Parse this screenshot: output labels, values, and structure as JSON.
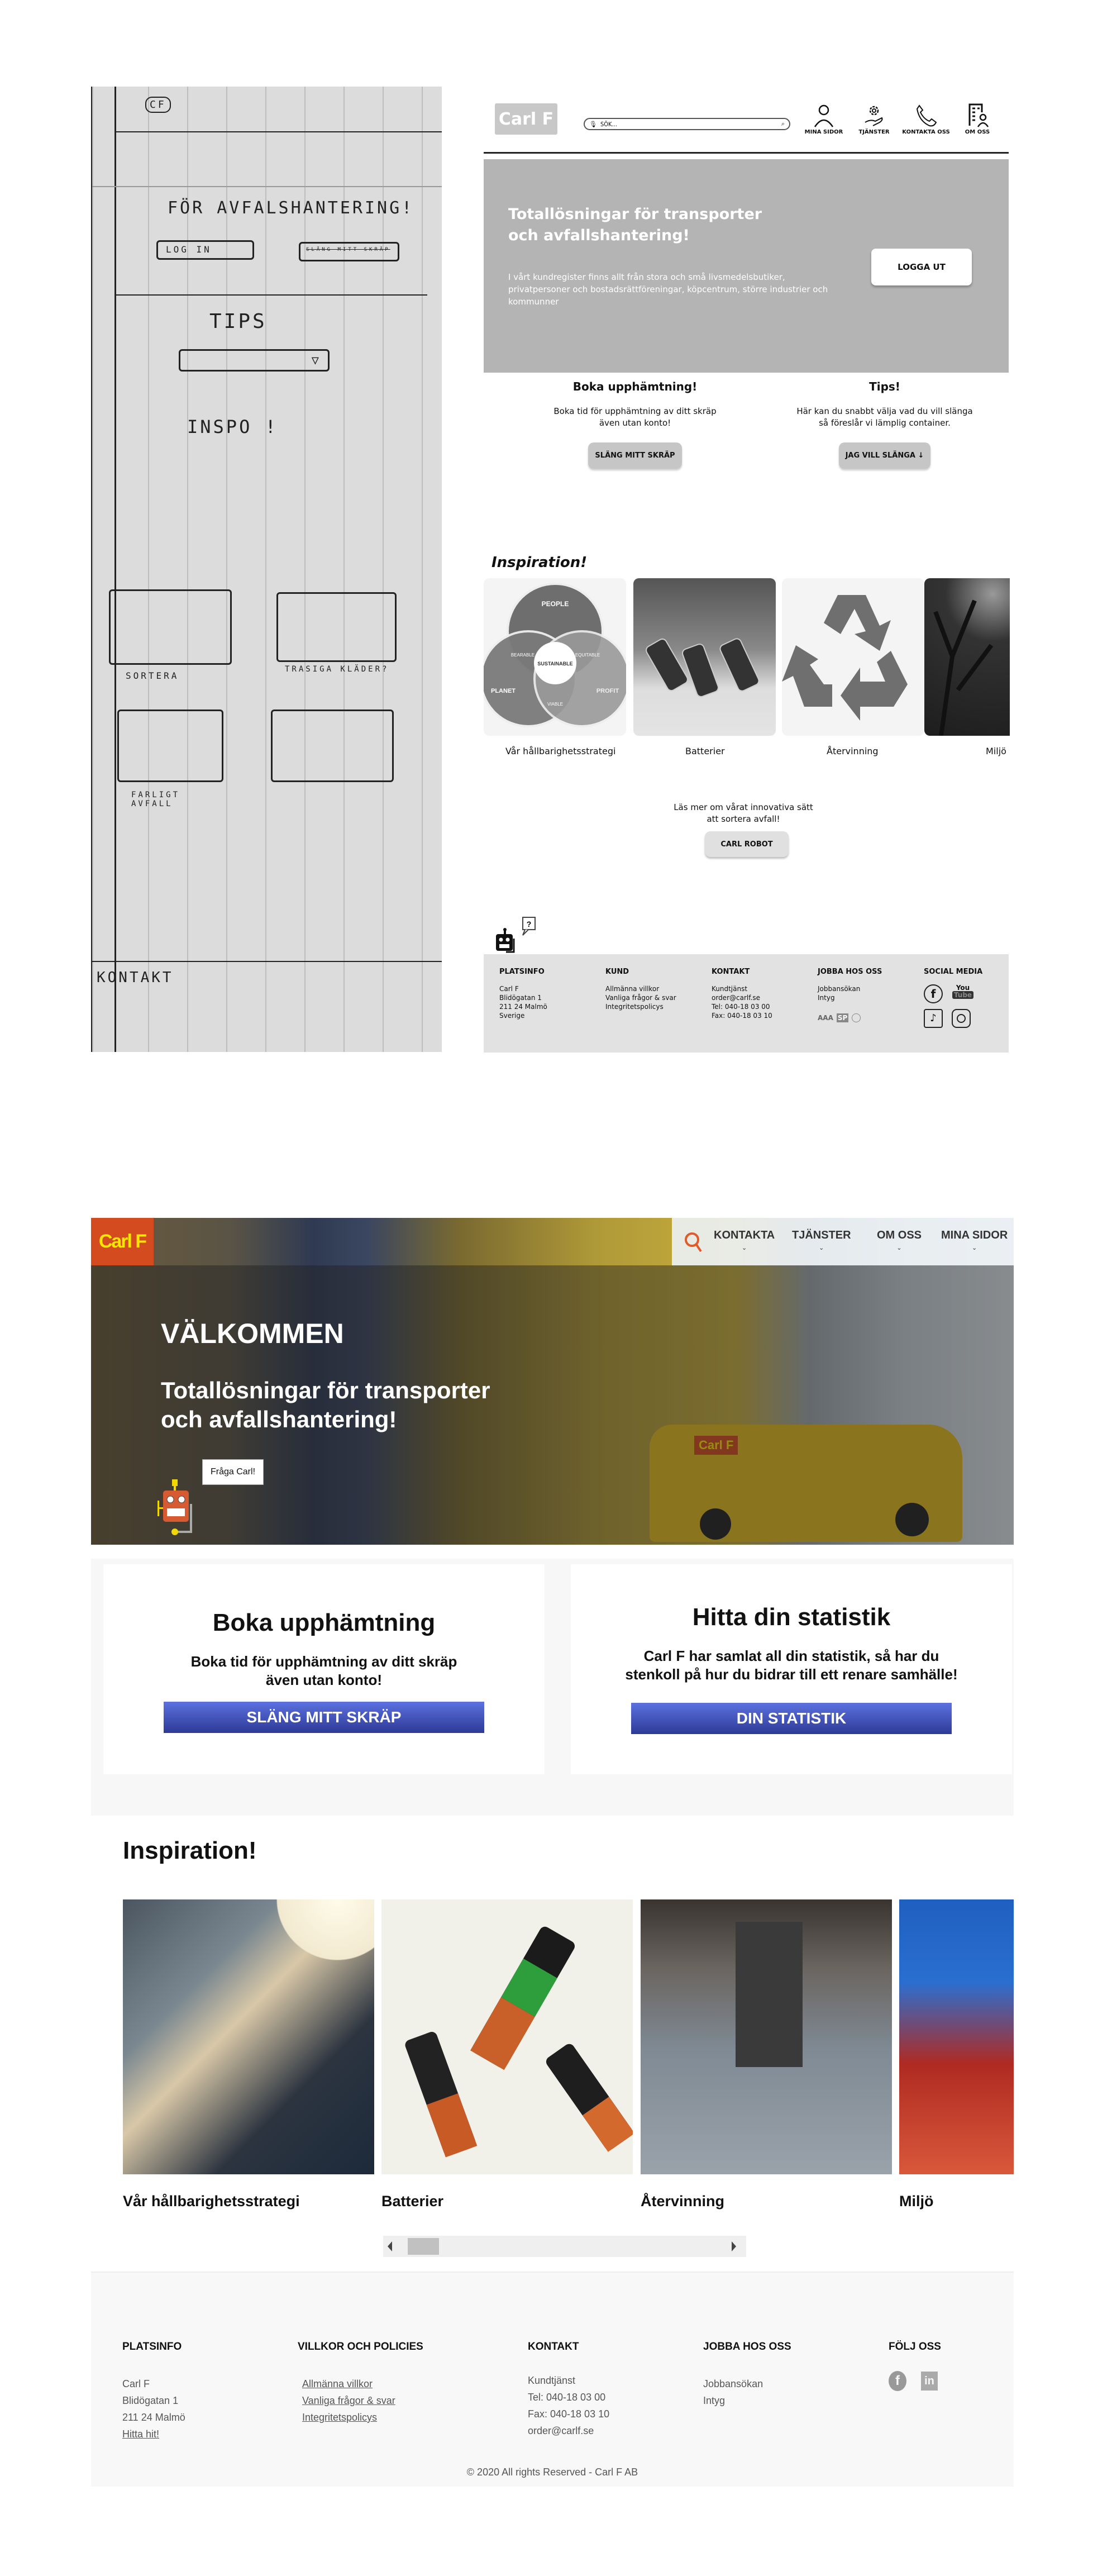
{
  "sketch": {
    "logo_scribble": "CF",
    "heading": "FÖR AVFALSHANTERING!",
    "login_button": "LOG IN",
    "second_button": "SLÄNG MITT SKRÄP",
    "tips_label": "TIPS",
    "inspo_label": "INSPO !",
    "cards": [
      {
        "label": "SORTERA"
      },
      {
        "label": "TRASIGA KLÄDER?"
      },
      {
        "label": "FARLIGT AVFALL"
      },
      {
        "label": ""
      }
    ],
    "footer_label": "KONTAKT"
  },
  "wireframe": {
    "logo": "Carl F",
    "search": {
      "placeholder": "SÖK..."
    },
    "nav": [
      {
        "label": "MINA SIDOR",
        "icon": "person-icon"
      },
      {
        "label": "TJÄNSTER",
        "icon": "gear-hand-icon"
      },
      {
        "label": "KONTAKTA OSS",
        "icon": "phone-icon"
      },
      {
        "label": "OM OSS",
        "icon": "building-person-icon"
      }
    ],
    "hero": {
      "title_line1": "Totallösningar för transporter",
      "title_line2": "och avfallshantering!",
      "body": "I vårt kundregister finns allt från stora och små livsmedelsbutiker, privatpersoner och bostadsrättföreningar, köpcentrum, större industrier och kommunner",
      "logout_button": "LOGGA UT"
    },
    "columns": [
      {
        "title": "Boka upphämtning!",
        "line1": "Boka tid för upphämtning av ditt skräp",
        "line2": "även utan konto!",
        "button": "SLÄNG MITT SKRÄP"
      },
      {
        "title": "Tips!",
        "line1": "Här kan du snabbt välja vad du vill slänga",
        "line2": "så föreslår vi lämplig container.",
        "button": "JAG VILL SLÄNGA ↓"
      }
    ],
    "inspiration": {
      "title": "Inspiration!",
      "venn": {
        "people": "PEOPLE",
        "planet": "PLANET",
        "profit": "PROFIT",
        "bearable": "BEARABLE",
        "equitable": "EQUITABLE",
        "viable": "VIABLE",
        "sustainable": "SUSTAINABLE"
      },
      "items": [
        {
          "caption": "Vår hållbarighetsstrategi"
        },
        {
          "caption": "Batterier"
        },
        {
          "caption": "Återvinning"
        },
        {
          "caption": "Miljö"
        }
      ]
    },
    "robot_cta": {
      "line1": "Läs mer om vårat innovativa sätt",
      "line2": "att sortera avfall!",
      "button": "CARL ROBOT"
    },
    "footer": {
      "columns": [
        {
          "title": "PLATSINFO",
          "lines": [
            "Carl F",
            "Blidögatan 1",
            "211 24 Malmö",
            "Sverige"
          ]
        },
        {
          "title": "KUND",
          "lines": [
            "Allmänna villkor",
            "Vanliga frågor & svar",
            "Integritetspolicys"
          ]
        },
        {
          "title": "KONTAKT",
          "lines": [
            "Kundtjänst",
            "order@carlf.se",
            "Tel: 040-18 03 00",
            "Fax: 040-18 03 10"
          ]
        },
        {
          "title": "JOBBA HOS OSS",
          "lines": [
            "Jobbansökan",
            "Intyg"
          ]
        },
        {
          "title": "SOCIAL MEDIA",
          "lines": []
        }
      ],
      "cert_badges": [
        "AAA",
        "SP",
        "Certifikat"
      ],
      "social": [
        "facebook-icon",
        "youtube-icon",
        "tiktok-icon",
        "instagram-icon"
      ]
    }
  },
  "final": {
    "logo": "Carl F",
    "nav": [
      {
        "label": "KONTAKTA"
      },
      {
        "label": "TJÄNSTER"
      },
      {
        "label": "OM OSS"
      },
      {
        "label": "MINA SIDOR"
      }
    ],
    "chevron": "⌄",
    "hero": {
      "welcome": "VÄLKOMMEN",
      "title_line1": "Totallösningar för transporter",
      "title_line2": "och avfallshantering!",
      "van_logo": "Carl F",
      "chat_bubble": "Fråga Carl!"
    },
    "cards": [
      {
        "title": "Boka upphämtning",
        "line1": "Boka tid för upphämtning av ditt skräp",
        "line2": "även utan konto!",
        "button": "SLÄNG MITT SKRÄP"
      },
      {
        "title": "Hitta din statistik",
        "line1": "Carl F har samlat all din statistik, så har du",
        "line2": "stenkoll på hur du bidrar till ett renare samhälle!",
        "button": "DIN STATISTIK"
      }
    ],
    "inspiration": {
      "title": "Inspiration!",
      "items": [
        {
          "caption": "Vår hållbarighetsstrategi"
        },
        {
          "caption": "Batterier"
        },
        {
          "caption": "Återvinning"
        },
        {
          "caption": "Miljö"
        }
      ],
      "scroll_position": 0.03
    },
    "footer": {
      "columns": [
        {
          "title": "PLATSINFO",
          "lines": [
            "Carl F",
            "Blidögatan 1",
            "211 24 Malmö"
          ],
          "link": "Hitta hit!"
        },
        {
          "title": "VILLKOR OCH POLICIES",
          "links": [
            "Allmänna villkor",
            "Vanliga frågor & svar",
            "Integritetspolicys"
          ]
        },
        {
          "title": "KONTAKT",
          "lines": [
            "Kundtjänst",
            "Tel: 040-18 03 00",
            "Fax: 040-18 03 10",
            "order@carlf.se"
          ]
        },
        {
          "title": "JOBBA HOS OSS",
          "lines": [
            "Jobbansökan",
            "Intyg"
          ]
        },
        {
          "title": "FÖLJ OSS",
          "social": [
            "facebook-icon",
            "linkedin-icon"
          ]
        }
      ],
      "copyright": "© 2020 All rights Reserved - Carl F AB"
    },
    "colors": {
      "brand_orange": "#d34b1f",
      "brand_yellow": "#f8e600",
      "button_blue": "#3f51c2",
      "search_icon": "#e05a2a"
    }
  }
}
